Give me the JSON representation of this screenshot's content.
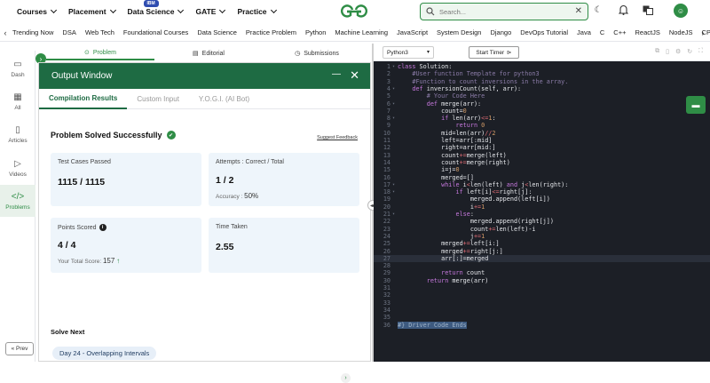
{
  "top_nav": {
    "menus": [
      {
        "label": "Courses"
      },
      {
        "label": "Placement"
      },
      {
        "label": "Data Science",
        "badge": "IBM"
      },
      {
        "label": "GATE"
      },
      {
        "label": "Practice"
      }
    ],
    "search_placeholder": "Search...",
    "brand_color": "#2f8d46"
  },
  "sub_nav": {
    "items": [
      "Trending Now",
      "DSA",
      "Web Tech",
      "Foundational Courses",
      "Data Science",
      "Practice Problem",
      "Python",
      "Machine Learning",
      "JavaScript",
      "System Design",
      "Django",
      "DevOps Tutorial",
      "Java",
      "C",
      "C++",
      "ReactJS",
      "NodeJS",
      "CP Live"
    ]
  },
  "sidebar": {
    "items": [
      {
        "label": "Dash",
        "icon": "dash-icon"
      },
      {
        "label": "All",
        "icon": "grid-icon"
      },
      {
        "label": "Articles",
        "icon": "book-icon"
      },
      {
        "label": "Videos",
        "icon": "video-icon"
      },
      {
        "label": "Problems",
        "icon": "code-icon",
        "active": true
      }
    ],
    "prev_label": "« Prev"
  },
  "problem_tabs": [
    {
      "label": "Problem",
      "icon": "problem-icon",
      "active": true
    },
    {
      "label": "Editorial",
      "icon": "editorial-icon"
    },
    {
      "label": "Submissions",
      "icon": "clock-icon"
    }
  ],
  "output_window": {
    "title": "Output Window",
    "tabs": [
      "Compilation Results",
      "Custom Input",
      "Y.O.G.I. (AI Bot)"
    ],
    "status": "Problem Solved Successfully",
    "feedback_link": "Suggest Feedback",
    "test_cases": {
      "label": "Test Cases Passed",
      "value": "1115 / 1115"
    },
    "attempts": {
      "label": "Attempts : Correct / Total",
      "value": "1 / 2",
      "accuracy_label": "Accuracy :",
      "accuracy_value": "50%"
    },
    "points": {
      "label": "Points Scored",
      "value": "4 / 4",
      "total_label": "Your Total Score:",
      "total_value": "157"
    },
    "time_taken": {
      "label": "Time Taken",
      "value": "2.55"
    },
    "solve_next_label": "Solve Next",
    "next_problem": "Day 24 - Overlapping Intervals"
  },
  "editor": {
    "language": "Python3",
    "timer_label": "Start Timer",
    "code_lines": [
      "class Solution:",
      "    #User function Template for python3",
      "    #Function to count inversions in the array.",
      "    def inversionCount(self, arr):",
      "        # Your Code Here",
      "        def merge(arr):",
      "            count=0",
      "            if len(arr)<=1:",
      "                return 0",
      "            mid=len(arr)//2",
      "            left=arr[:mid]",
      "            right=arr[mid:]",
      "            count+=merge(left)",
      "            count+=merge(right)",
      "            i=j=0",
      "            merged=[]",
      "            while i<len(left) and j<len(right):",
      "                if left[i]<=right[j]:",
      "                    merged.append(left[i])",
      "                    i+=1",
      "                else:",
      "                    merged.append(right[j])",
      "                    count+=len(left)-i",
      "                    j+=1",
      "            merged+=left[i:]",
      "            merged+=right[j:]",
      "            arr[:]=merged",
      "",
      "            return count",
      "        return merge(arr)",
      "",
      "",
      "",
      "",
      "",
      "#} Driver Code Ends"
    ],
    "current_line": 27
  }
}
